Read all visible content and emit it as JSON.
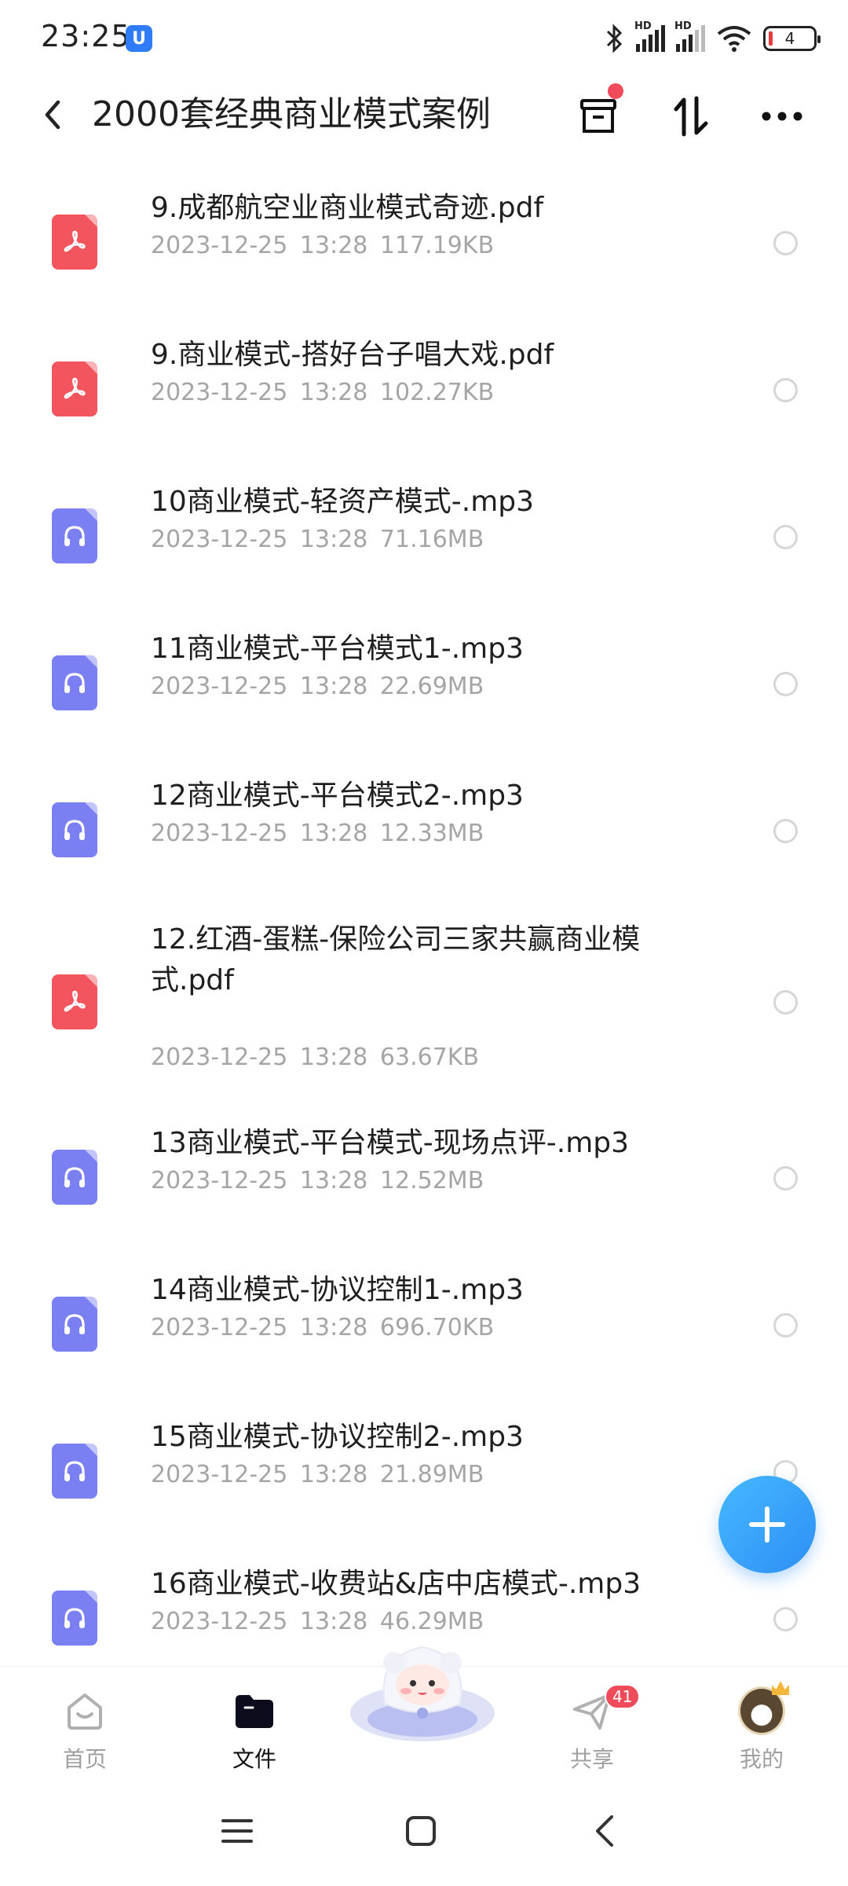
{
  "status_bar": {
    "time": "23:25",
    "notification_icon": "u-app-icon",
    "signal_hd_1": "HD",
    "signal_hd_2": "HD",
    "battery_level": "4",
    "icons": [
      "bluetooth-icon",
      "signal-icon",
      "signal-icon",
      "wifi-icon",
      "battery-icon"
    ]
  },
  "header": {
    "title": "2000套经典商业模式案例",
    "back_icon": "chevron-left-icon",
    "actions": [
      "archive-icon",
      "sort-icon",
      "more-icon"
    ],
    "archive_has_dot": true
  },
  "files": [
    {
      "name": "9.成都航空业商业模式奇迹.pdf",
      "date": "2023-12-25",
      "time": "13:28",
      "size": "117.19KB",
      "type": "pdf"
    },
    {
      "name": "9.商业模式-搭好台子唱大戏.pdf",
      "date": "2023-12-25",
      "time": "13:28",
      "size": "102.27KB",
      "type": "pdf"
    },
    {
      "name": "10商业模式-轻资产模式-.mp3",
      "date": "2023-12-25",
      "time": "13:28",
      "size": "71.16MB",
      "type": "mp3"
    },
    {
      "name": "11商业模式-平台模式1-.mp3",
      "date": "2023-12-25",
      "time": "13:28",
      "size": "22.69MB",
      "type": "mp3"
    },
    {
      "name": "12商业模式-平台模式2-.mp3",
      "date": "2023-12-25",
      "time": "13:28",
      "size": "12.33MB",
      "type": "mp3"
    },
    {
      "name": "12.红酒-蛋糕-保险公司三家共赢商业模式.pdf",
      "date": "2023-12-25",
      "time": "13:28",
      "size": "63.67KB",
      "type": "pdf"
    },
    {
      "name": "13商业模式-平台模式-现场点评-.mp3",
      "date": "2023-12-25",
      "time": "13:28",
      "size": "12.52MB",
      "type": "mp3"
    },
    {
      "name": "14商业模式-协议控制1-.mp3",
      "date": "2023-12-25",
      "time": "13:28",
      "size": "696.70KB",
      "type": "mp3"
    },
    {
      "name": "15商业模式-协议控制2-.mp3",
      "date": "2023-12-25",
      "time": "13:28",
      "size": "21.89MB",
      "type": "mp3"
    },
    {
      "name": "16商业模式-收费站&店中店模式-.mp3",
      "date": "2023-12-25",
      "time": "13:28",
      "size": "46.29MB",
      "type": "mp3"
    }
  ],
  "fab": {
    "icon": "plus-icon"
  },
  "bottom_nav": {
    "items": [
      {
        "label": "首页",
        "icon": "home-icon",
        "active": false
      },
      {
        "label": "文件",
        "icon": "folder-icon",
        "active": true
      },
      {
        "label": "共享",
        "icon": "send-icon",
        "active": false,
        "badge": "41"
      },
      {
        "label": "我的",
        "icon": "avatar-icon",
        "active": false
      }
    ],
    "center_icon": "mascot-icon"
  },
  "system_nav": [
    "menu-icon",
    "home-square-icon",
    "back-icon"
  ],
  "colors": {
    "pdf": "#f2555d",
    "mp3": "#7a7ff2",
    "fab": "#3aa6fb",
    "badge": "#f04b5b",
    "meta_text": "#a5a5a5"
  }
}
